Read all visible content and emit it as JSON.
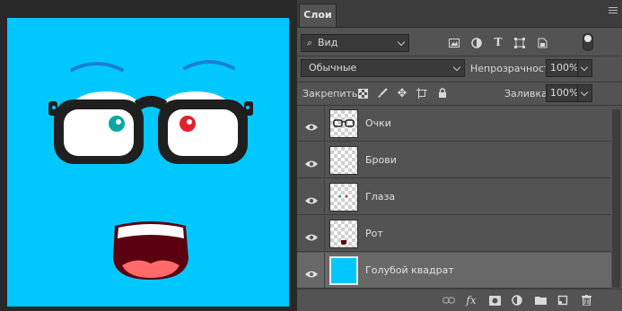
{
  "panel": {
    "tab_label": "Слои",
    "filter": {
      "value": "Вид",
      "icon": "search-icon"
    },
    "filter_icons": [
      "image-filter-icon",
      "adjustment-filter-icon",
      "text-filter-icon",
      "shape-filter-icon",
      "smart-object-filter-icon"
    ],
    "blend_mode": "Обычные",
    "opacity_label": "Непрозрачность:",
    "opacity_value": "100%",
    "lock_label": "Закрепить:",
    "lock_icons": [
      "lock-transparent-icon",
      "lock-image-icon",
      "lock-position-icon",
      "lock-artboard-icon",
      "lock-all-icon"
    ],
    "fill_label": "Заливка:",
    "fill_value": "100%"
  },
  "layers": [
    {
      "name": "Очки",
      "visible": true,
      "thumb": "glasses"
    },
    {
      "name": "Брови",
      "visible": true,
      "thumb": "empty"
    },
    {
      "name": "Глаза",
      "visible": true,
      "thumb": "eyes"
    },
    {
      "name": "Рот",
      "visible": true,
      "thumb": "mouth"
    },
    {
      "name": "Голубой квадрат",
      "visible": true,
      "thumb": "solid",
      "selected": true
    }
  ],
  "footer_icons": [
    "link-icon",
    "fx-icon",
    "mask-icon",
    "adjustment-icon",
    "folder-icon",
    "new-layer-icon",
    "trash-icon"
  ],
  "footer_fx_label": "fx",
  "colors": {
    "canvas_bg": "#00c8ff",
    "panel_bg": "#535353",
    "selected_layer": "#686868"
  }
}
